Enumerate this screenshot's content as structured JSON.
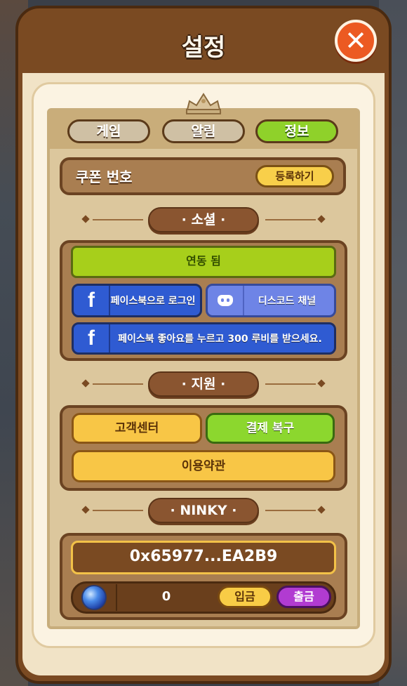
{
  "window": {
    "title": "설정"
  },
  "tabs": [
    {
      "label": "게임",
      "active": false
    },
    {
      "label": "알림",
      "active": false
    },
    {
      "label": "정보",
      "active": true
    }
  ],
  "coupon": {
    "label": "쿠폰 번호",
    "button": "등록하기"
  },
  "social": {
    "header": "· 소셜 ·",
    "linked_label": "연동 됨",
    "facebook_login": "페이스북으로 로그인",
    "discord": "디스코드 채널",
    "facebook_like": "페이스북 좋아요를 누르고 300 루비를 받으세요."
  },
  "support": {
    "header": "· 지원 ·",
    "customer_center": "고객센터",
    "payment_restore": "결제 복구",
    "terms": "이용약관"
  },
  "ninky": {
    "header": "· NINKY ·",
    "wallet": "0x65977...EA2B9",
    "ruby_balance": "0",
    "deposit": "입금",
    "withdraw": "출금"
  },
  "colors": {
    "panel_brown": "#7a4a22",
    "tab_active": "#8fd12a",
    "yellow_button": "#f8cf4a",
    "close_orange": "#ec5a22",
    "facebook_blue": "#2f5bd2",
    "discord_blue": "#6e84e6",
    "withdraw_purple": "#b13bd1"
  },
  "icons": {
    "close": "close-icon",
    "facebook": "facebook-icon",
    "discord": "discord-icon",
    "gem": "blue-gem-icon",
    "crown": "crown-icon"
  }
}
